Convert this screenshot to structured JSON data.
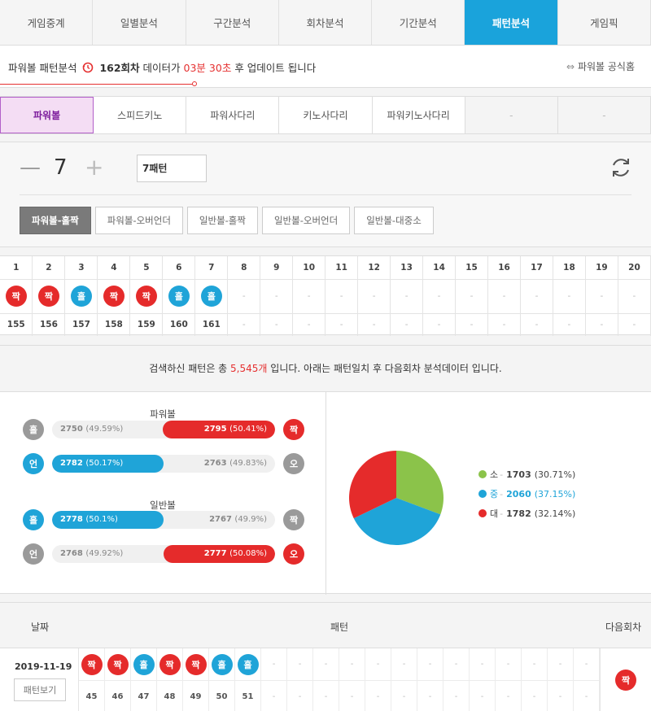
{
  "topnav": {
    "tabs": [
      "게임중계",
      "일별분석",
      "구간분석",
      "회차분석",
      "기간분석",
      "패턴분석",
      "게임픽"
    ],
    "active_index": 5
  },
  "infobar": {
    "prefix": "파워볼 패턴분석",
    "round": "162회차",
    "mid": "데이터가",
    "countdown": "03분 30초",
    "suffix": "후 업데이트 됩니다",
    "official_link": "파워볼 공식홈"
  },
  "gametabs": {
    "tabs": [
      "파워볼",
      "스피드키노",
      "파워사다리",
      "키노사다리",
      "파워키노사다리",
      "-",
      "-"
    ],
    "active_index": 0
  },
  "controls": {
    "count": "7",
    "pattern_input": "7패턴",
    "pattern_tabs": [
      "파워볼-홀짝",
      "파워볼-오버언더",
      "일반볼-홀짝",
      "일반볼-오버언더",
      "일반볼-대중소"
    ],
    "active_index": 0
  },
  "grid": {
    "columns": [
      "1",
      "2",
      "3",
      "4",
      "5",
      "6",
      "7",
      "8",
      "9",
      "10",
      "11",
      "12",
      "13",
      "14",
      "15",
      "16",
      "17",
      "18",
      "19",
      "20"
    ],
    "balls": [
      "짝",
      "짝",
      "홀",
      "짝",
      "짝",
      "홀",
      "홀",
      "-",
      "-",
      "-",
      "-",
      "-",
      "-",
      "-",
      "-",
      "-",
      "-",
      "-",
      "-",
      "-"
    ],
    "ball_colors": [
      "red",
      "red",
      "blue",
      "red",
      "red",
      "blue",
      "blue",
      "",
      "",
      "",
      "",
      "",
      "",
      "",
      "",
      "",
      "",
      "",
      "",
      ""
    ],
    "rounds": [
      "155",
      "156",
      "157",
      "158",
      "159",
      "160",
      "161",
      "-",
      "-",
      "-",
      "-",
      "-",
      "-",
      "-",
      "-",
      "-",
      "-",
      "-",
      "-",
      "-"
    ]
  },
  "analysis": {
    "head_prefix": "검색하신 패턴은 총",
    "total": "5,545개",
    "head_suffix": "입니다. 아래는 패턴일치 후 다음회차 분석데이터 입니다.",
    "powerball_title": "파워볼",
    "normalball_title": "일반볼",
    "rows": [
      {
        "left_label": "홀",
        "left_color": "gray",
        "left_value": "2750",
        "left_pct": "(49.59%)",
        "right_value": "2795",
        "right_pct": "(50.41%)",
        "right_label": "짝",
        "right_color": "red",
        "winner": "right",
        "fill_color": "red",
        "fill_fraction": 0.5041
      },
      {
        "left_label": "언",
        "left_color": "blue",
        "left_value": "2782",
        "left_pct": "(50.17%)",
        "right_value": "2763",
        "right_pct": "(49.83%)",
        "right_label": "오",
        "right_color": "gray",
        "winner": "left",
        "fill_color": "blue",
        "fill_fraction": 0.5017
      },
      {
        "left_label": "홀",
        "left_color": "blue",
        "left_value": "2778",
        "left_pct": "(50.1%)",
        "right_value": "2767",
        "right_pct": "(49.9%)",
        "right_label": "짝",
        "right_color": "gray",
        "winner": "left",
        "fill_color": "blue",
        "fill_fraction": 0.501
      },
      {
        "left_label": "언",
        "left_color": "gray",
        "left_value": "2768",
        "left_pct": "(49.92%)",
        "right_value": "2777",
        "right_pct": "(50.08%)",
        "right_label": "오",
        "right_color": "red",
        "winner": "right",
        "fill_color": "red",
        "fill_fraction": 0.5008
      }
    ],
    "pie": [
      {
        "label": "소",
        "value": "1703",
        "pct": "(30.71%)",
        "color": "#8bc34a",
        "fraction": 0.3071
      },
      {
        "label": "중",
        "value": "2060",
        "pct": "(37.15%)",
        "color": "#1fa4d8",
        "fraction": 0.3715
      },
      {
        "label": "대",
        "value": "1782",
        "pct": "(32.14%)",
        "color": "#e52b2b",
        "fraction": 0.3214
      }
    ]
  },
  "history": {
    "col_date": "날짜",
    "col_pattern": "패턴",
    "col_next": "다음회차",
    "rows": [
      {
        "date": "2019-11-19",
        "view_button": "패턴보기",
        "balls": [
          "짝",
          "짝",
          "홀",
          "짝",
          "짝",
          "홀",
          "홀",
          "-",
          "-",
          "-",
          "-",
          "-",
          "-",
          "-",
          "-",
          "-",
          "-",
          "-",
          "-",
          "-"
        ],
        "ball_colors": [
          "red",
          "red",
          "blue",
          "red",
          "red",
          "blue",
          "blue",
          "",
          "",
          "",
          "",
          "",
          "",
          "",
          "",
          "",
          "",
          "",
          "",
          ""
        ],
        "rounds": [
          "45",
          "46",
          "47",
          "48",
          "49",
          "50",
          "51",
          "-",
          "-",
          "-",
          "-",
          "-",
          "-",
          "-",
          "-",
          "-",
          "-",
          "-",
          "-",
          "-"
        ],
        "next": "짝",
        "next_color": "red"
      }
    ]
  }
}
